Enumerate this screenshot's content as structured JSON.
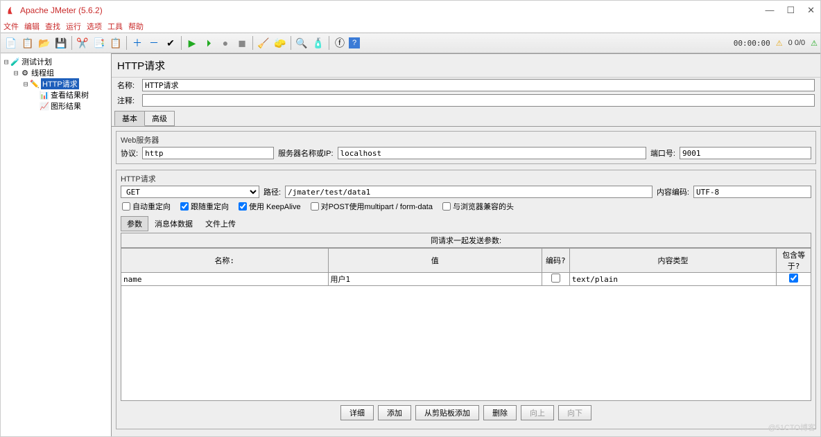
{
  "window": {
    "title": "Apache JMeter (5.6.2)"
  },
  "menubar": [
    "文件",
    "编辑",
    "查找",
    "运行",
    "选项",
    "工具",
    "帮助"
  ],
  "toolbar_timer": "00:00:00",
  "toolbar_counts": "0 0/0",
  "tree": {
    "plan": "测试计划",
    "thread_group": "线程组",
    "http_request": "HTTP请求",
    "view_results_tree": "查看结果树",
    "graph_results": "图形结果"
  },
  "panel": {
    "title": "HTTP请求",
    "name_label": "名称:",
    "name_value": "HTTP请求",
    "comment_label": "注释:",
    "comment_value": "",
    "tabs": {
      "basic": "基本",
      "advanced": "高级"
    },
    "web_server": {
      "legend": "Web服务器",
      "protocol_label": "协议:",
      "protocol": "http",
      "server_label": "服务器名称或IP:",
      "server": "localhost",
      "port_label": "端口号:",
      "port": "9001"
    },
    "http_request": {
      "legend": "HTTP请求",
      "method": "GET",
      "path_label": "路径:",
      "path": "/jmater/test/data1",
      "encoding_label": "内容编码:",
      "encoding": "UTF-8"
    },
    "checkboxes": {
      "auto_redirect": "自动重定向",
      "follow_redirect": "跟随重定向",
      "keepalive": "使用 KeepAlive",
      "multipart": "对POST使用multipart / form-data",
      "browser_headers": "与浏览器兼容的头"
    },
    "param_tabs": {
      "params": "参数",
      "body": "消息体数据",
      "files": "文件上传"
    },
    "param_table": {
      "caption": "同请求一起发送参数:",
      "cols": {
        "name": "名称:",
        "value": "值",
        "encode": "编码?",
        "ctype": "内容类型",
        "include": "包含等于?"
      },
      "rows": [
        {
          "name": "name",
          "value": "用户1",
          "encode": false,
          "ctype": "text/plain",
          "include": true
        }
      ]
    },
    "buttons": {
      "detail": "详细",
      "add": "添加",
      "clipboard": "从剪贴板添加",
      "delete": "删除",
      "up": "向上",
      "down": "向下"
    }
  },
  "watermark": "@51CTO博客"
}
